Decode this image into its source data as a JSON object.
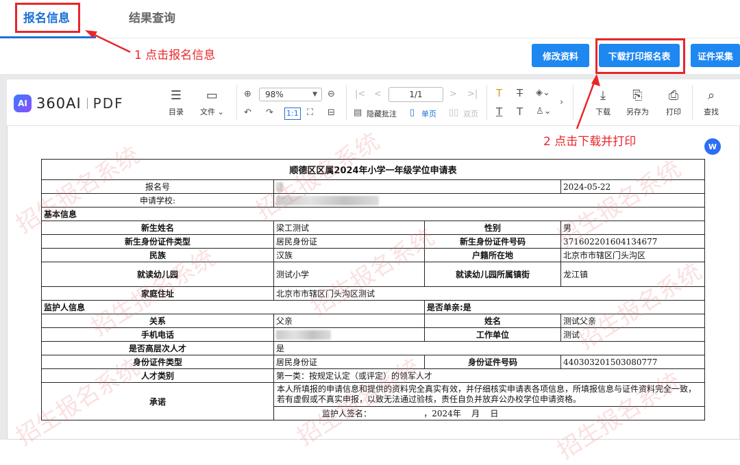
{
  "tabs": [
    {
      "label": "报名信息"
    },
    {
      "label": "结果查询"
    }
  ],
  "annotations": {
    "step1": "1 点击报名信息",
    "step2": "2 点击下载并打印"
  },
  "actions": {
    "modify": "修改资料",
    "download_print": "下载打印报名表",
    "certificate": "证件采集"
  },
  "viewer": {
    "logo_ai": "AI",
    "logo_brand": "360AI",
    "logo_pdf": "PDF",
    "toolbar": {
      "toc": "目录",
      "file": "文件",
      "zoom": "98%",
      "page": "1/1",
      "hide_annot": "隐藏批注",
      "single_page": "单页",
      "double_page": "双页",
      "download": "下载",
      "save_as": "另存为",
      "print": "打印",
      "find": "查找"
    },
    "word_badge": "W"
  },
  "document": {
    "title": "顺德区区属2024年小学一年级学位申请表",
    "reg_no_label": "报名号",
    "reg_date": "2024-05-22",
    "school_label": "申请学校:",
    "basic_section": "基本信息",
    "name_label": "新生姓名",
    "name_value": "梁工测试",
    "gender_label": "性别",
    "gender_value": "男",
    "id_type_label": "新生身份证件类型",
    "id_type_value": "居民身份证",
    "id_no_label": "新生身份证件号码",
    "id_no_value": "371602201604134677",
    "ethnic_label": "民族",
    "ethnic_value": "汉族",
    "hukou_label": "户籍所在地",
    "hukou_value": "北京市市辖区门头沟区",
    "kinder_label": "就读幼儿园",
    "kinder_value": "测试小学",
    "kinder_town_label": "就读幼儿园所属镇街",
    "kinder_town_value": "龙江镇",
    "address_label": "家庭住址",
    "address_value": "北京市市辖区门头沟区测试",
    "guardian_section": "监护人信息",
    "single_parent": "是否单亲:是",
    "relation_label": "关系",
    "relation_value": "父亲",
    "g_name_label": "姓名",
    "g_name_value": "测试父亲",
    "phone_label": "手机电话",
    "work_label": "工作单位",
    "work_value": "测试",
    "talent_label": "是否高层次人才",
    "talent_value": "是",
    "g_id_type_label": "身份证件类型",
    "g_id_type_value": "居民身份证",
    "g_id_no_label": "身份证件号码",
    "g_id_no_value": "440303201503080777",
    "talent_type_label": "人才类别",
    "talent_type_value": "第一类：按规定认定（或评定）的领军人才",
    "pledge_label": "承诺",
    "pledge_text": "本人所填报的申请信息和提供的资料完全真实有效，并仔细核实申请表各项信息，所填报信息与证件资料完全一致，若有虚假或不真实申报，以致无法通过验核，责任自负并放弃公办校学位申请资格。",
    "signature": "监护人签名：                    ，2024年    月    日"
  },
  "watermark_text": "招生报名系统",
  "colors": {
    "accent": "#1e6fd9",
    "button": "#1e87f0",
    "annotation": "#e8262a"
  }
}
